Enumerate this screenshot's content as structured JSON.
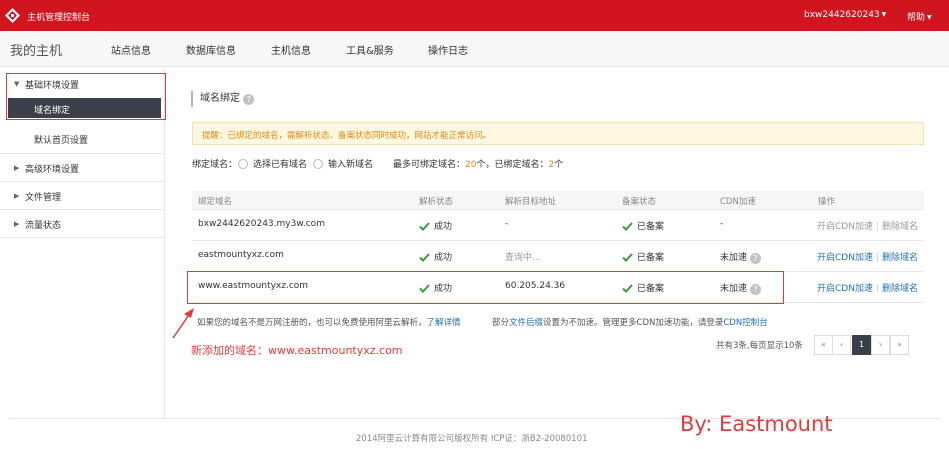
{
  "topbar": {
    "title": "主机管理控制台",
    "user": "bxw2442620243",
    "help": "帮助"
  },
  "navbar": {
    "brand": "我的主机",
    "items": [
      "站点信息",
      "数据库信息",
      "主机信息",
      "工具&服务",
      "操作日志"
    ]
  },
  "sidebar": {
    "groups": [
      {
        "label": "基础环境设置",
        "expanded": true
      },
      {
        "label": "高级环境设置",
        "expanded": false
      },
      {
        "label": "文件管理",
        "expanded": false
      },
      {
        "label": "流量状态",
        "expanded": false
      }
    ],
    "active_item": "域名绑定",
    "sub_item": "默认首页设置"
  },
  "main": {
    "section_title": "域名绑定",
    "tip": "提醒：已绑定的域名，需解析状态、备案状态同时成功，网站才能正常访问。",
    "bind": {
      "label": "绑定域名：",
      "option1": "选择已有域名",
      "option2": "输入新域名",
      "max_label": "最多可绑定域名：",
      "max_count": "20",
      "unit1": "个，已绑定域名：",
      "bound_count": "2",
      "unit2": "个"
    },
    "table": {
      "headers": [
        "绑定域名",
        "解析状态",
        "解析目标地址",
        "备案状态",
        "CDN加速",
        "操作"
      ],
      "rows": [
        {
          "domain": "bxw2442620243.my3w.com",
          "resolve": "成功",
          "target": "-",
          "record": "已备案",
          "cdn": "-",
          "op1": "开启CDN加速",
          "op2": "删除域名"
        },
        {
          "domain": "eastmountyxz.com",
          "resolve": "成功",
          "target": "查询中...",
          "record": "已备案",
          "cdn": "未加速",
          "op1": "开启CDN加速",
          "op2": "删除域名"
        },
        {
          "domain": "www.eastmountyxz.com",
          "resolve": "成功",
          "target": "60.205.24.36",
          "record": "已备案",
          "cdn": "未加速",
          "op1": "开启CDN加速",
          "op2": "删除域名"
        }
      ]
    },
    "note": {
      "text": "如果您的域名不是万网注册的，也可以免费使用阿里云解析，",
      "link": "了解详情"
    },
    "note2": {
      "prefix": "部分",
      "link1": "文件后缀",
      "middle": "设置为不加速。管理更多CDN加速功能，请登录",
      "link2": "CDN控制台"
    },
    "annotation": "新添加的域名：www.eastmountyxz.com",
    "pager": {
      "info": "共有3条,每页显示10条",
      "first": "«",
      "prev": "‹",
      "current": "1",
      "next": "›",
      "last": "»"
    }
  },
  "footer": "2014阿里云计算有限公司版权所有 ICP证：浙B2-20080101",
  "signature": "By: Eastmount",
  "colors": {
    "brand_red": "#d1151f",
    "sidebar_active": "#3a4049",
    "link_blue": "#1f6fbf",
    "annotation_red": "#e33b3b",
    "success_green": "#3b9a3b"
  }
}
